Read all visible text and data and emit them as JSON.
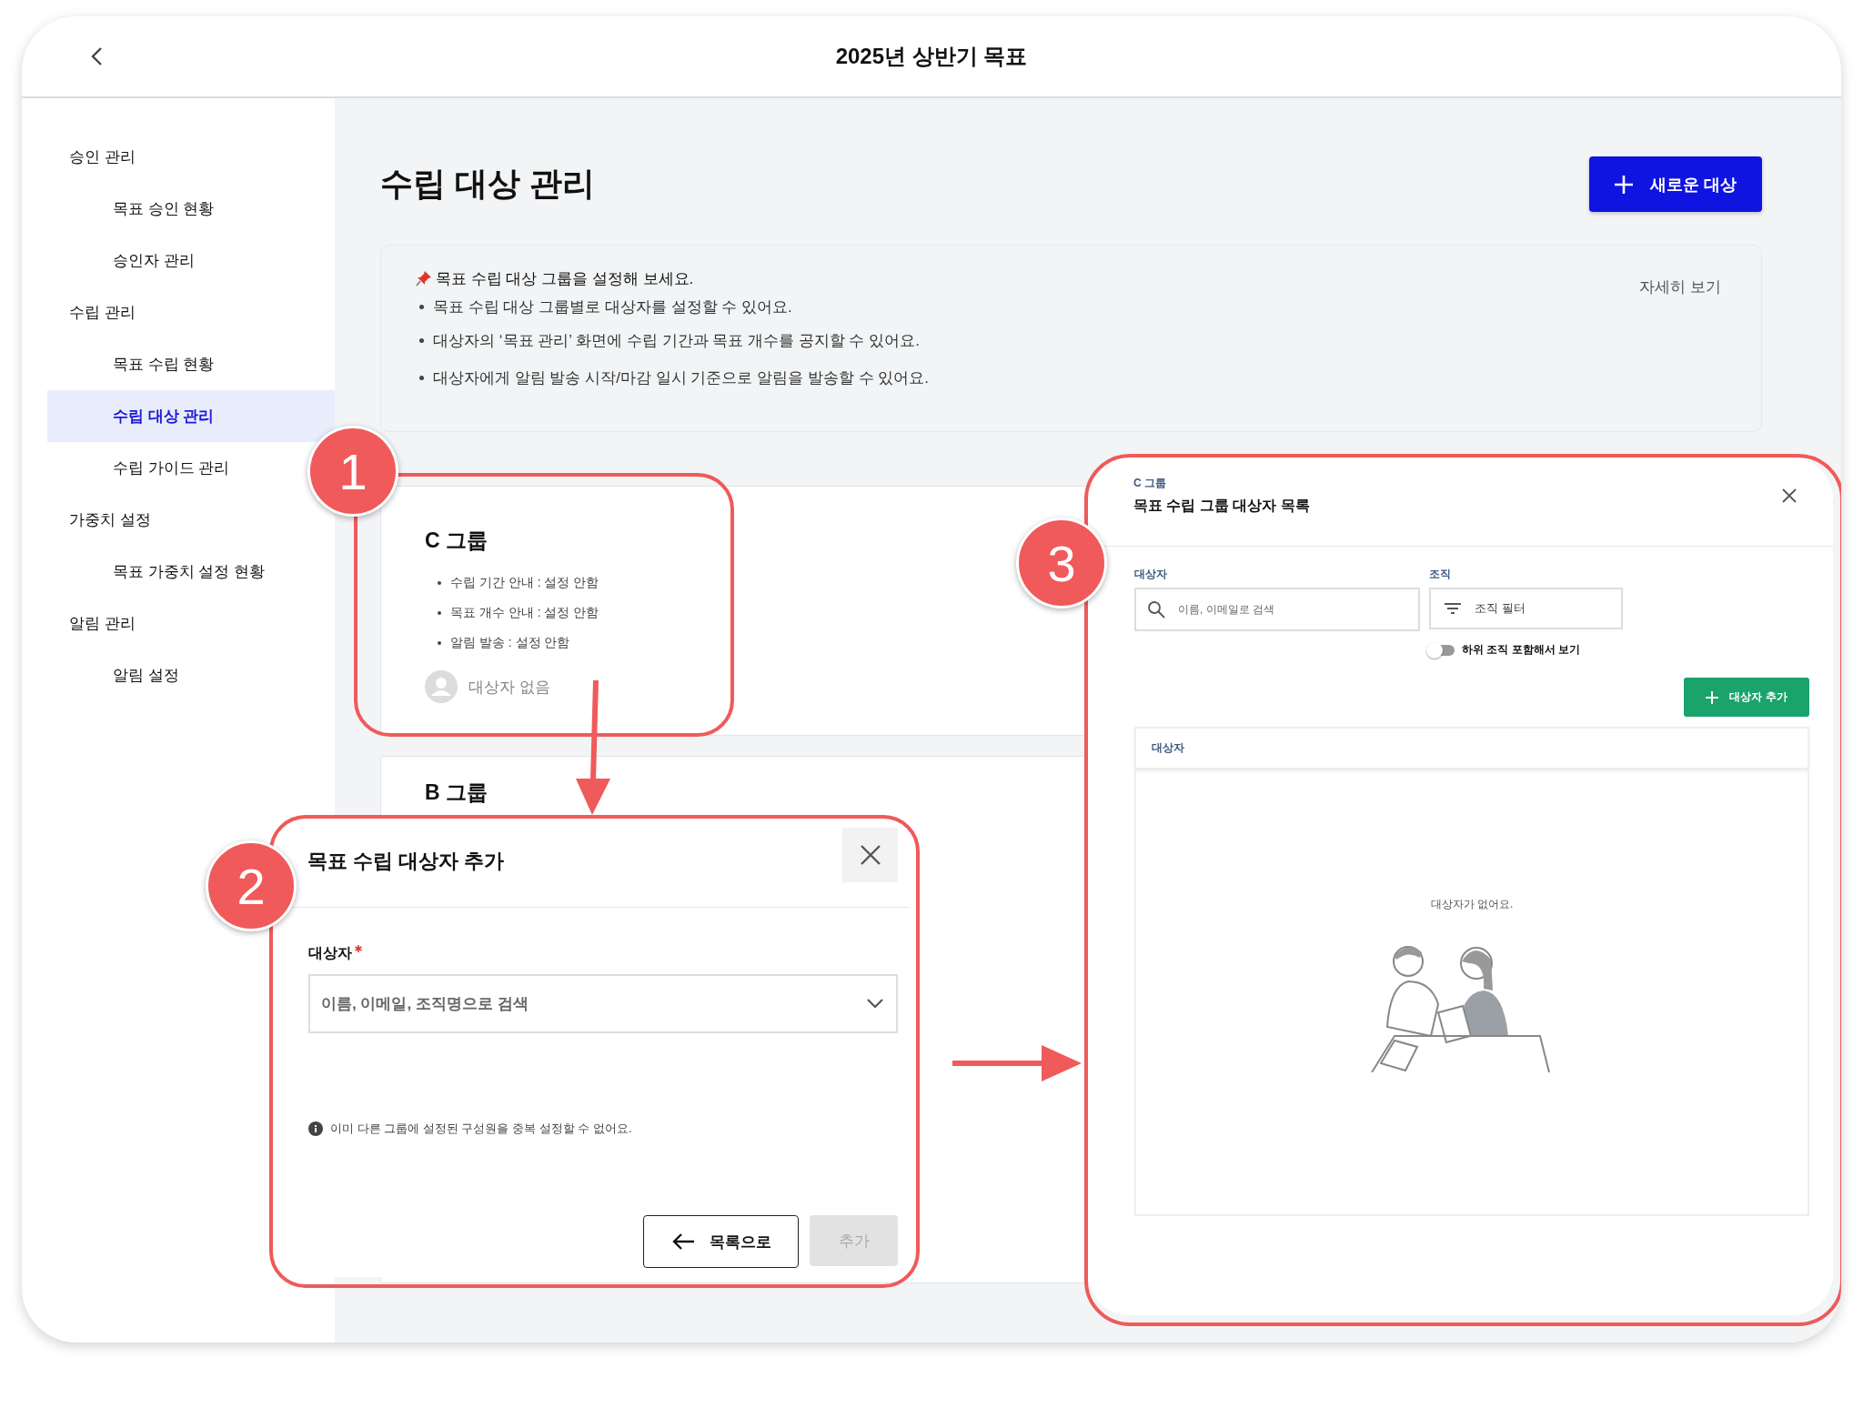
{
  "header": {
    "title": "2025년 상반기 목표"
  },
  "sidebar": {
    "items": [
      {
        "label": "승인 관리",
        "selected": false,
        "children": [
          {
            "label": "목표 승인 현황",
            "selected": false
          },
          {
            "label": "승인자 관리",
            "selected": false
          }
        ]
      },
      {
        "label": "수립 관리",
        "selected": false,
        "children": [
          {
            "label": "목표 수립 현황",
            "selected": false
          },
          {
            "label": "수립 대상 관리",
            "selected": true
          },
          {
            "label": "수립 가이드 관리",
            "selected": false
          }
        ]
      },
      {
        "label": "가중치 설정",
        "selected": false,
        "children": [
          {
            "label": "목표 가중치 설정 현황",
            "selected": false
          }
        ]
      },
      {
        "label": "알림 관리",
        "selected": false,
        "children": [
          {
            "label": "알림 설정",
            "selected": false
          }
        ]
      }
    ]
  },
  "page": {
    "title": "수립 대상 관리",
    "new_button": "새로운 대상",
    "info": {
      "heading": "목표 수립 대상 그룹을 설정해 보세요.",
      "bullets": [
        "목표 수립 대상 그룹별로 대상자를 설정할 수 있어요.",
        "대상자의 ‘목표 관리’ 화면에 수립 기간과 목표 개수를 공지할 수 있어요.",
        "대상자에게 알림 발송 시작/마감 일시 기준으로 알림을 발송할 수 있어요."
      ],
      "detail_link": "자세히 보기"
    },
    "groups": [
      {
        "name": "C 그룹",
        "lines": [
          "수립 기간 안내 : 설정 안함",
          "목표 개수 안내 : 설정 안함",
          "알림 발송 : 설정 안함"
        ],
        "targets": "대상자 없음"
      },
      {
        "name": "B 그룹"
      }
    ]
  },
  "callouts": [
    "1",
    "2",
    "3"
  ],
  "add_dialog": {
    "title": "목표 수립 대상자 추가",
    "field_label": "대상자",
    "required": true,
    "placeholder": "이름, 이메일, 조직명으로 검색",
    "notice": "이미 다른 그룹에 설정된 구성원을 중복 설정할 수 없어요.",
    "back_button": "목록으로",
    "add_button": {
      "label": "추가",
      "disabled": true
    }
  },
  "member_panel": {
    "group": "C 그룹",
    "title": "목표 수립 그룹 대상자 목록",
    "search_label": "대상자",
    "search_placeholder": "이름, 이메일로 검색",
    "org_label": "조직",
    "org_filter": "조직 필터",
    "include_sub": {
      "label": "하위 조직 포함해서 보기",
      "on": false
    },
    "add_button": "대상자 추가",
    "column": "대상자",
    "empty": "대상자가 없어요."
  }
}
